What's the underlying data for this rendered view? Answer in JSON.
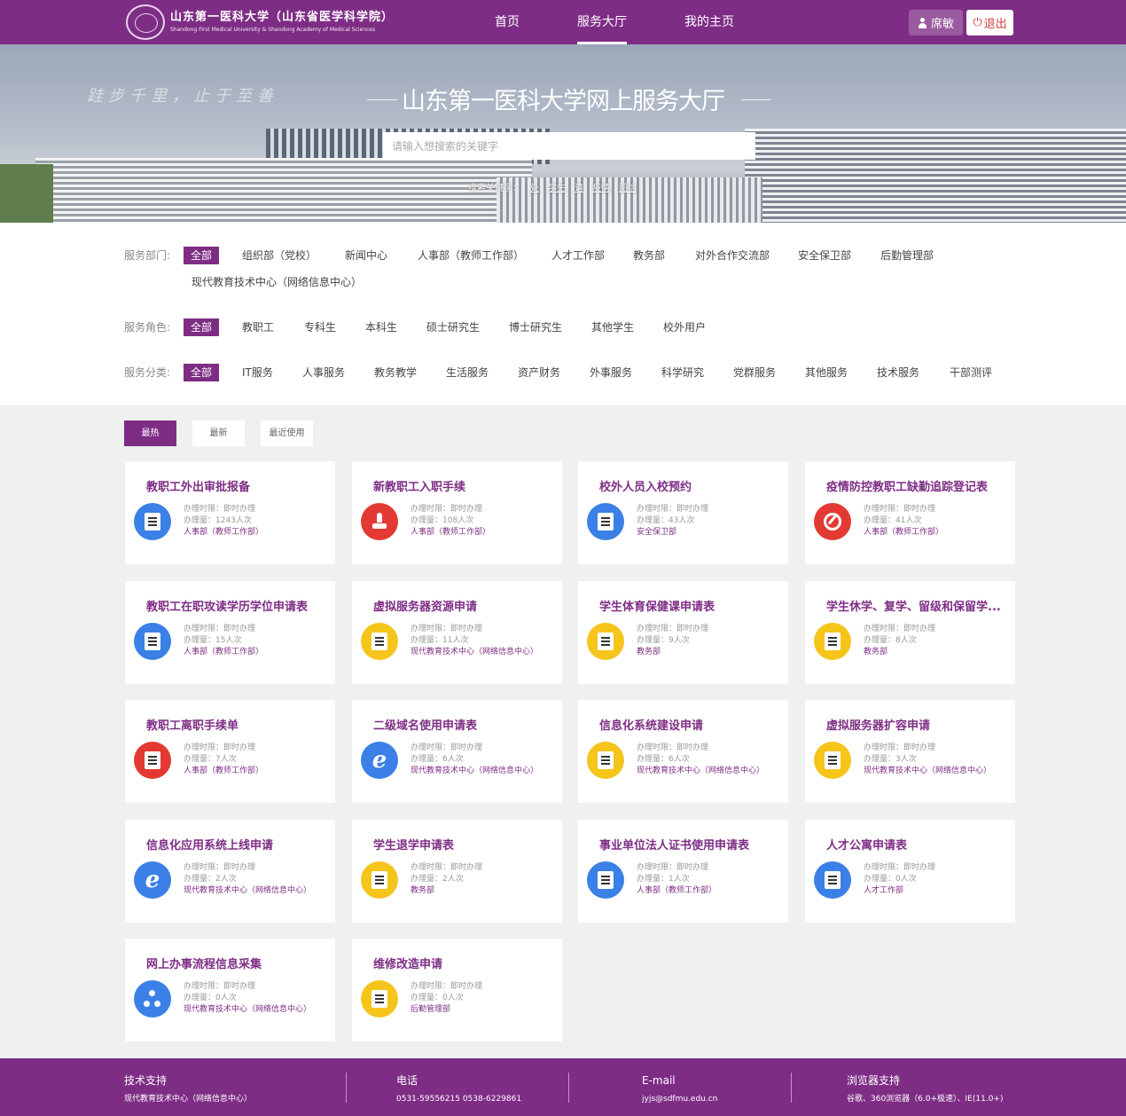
{
  "header": {
    "logo_cn": "山东第一医科大学（山东省医学科学院）",
    "logo_en": "Shandong First Medical University & Shandong Academy of Medical Sciences",
    "nav": [
      "首页",
      "服务大厅",
      "我的主页"
    ],
    "active_nav": "服务大厅",
    "user_name": "席敏",
    "logout_label": "退出"
  },
  "banner": {
    "calligraphy": "跬步千里，止于至善",
    "title": "山东第一医科大学网上服务大厅",
    "search_placeholder": "请输入想搜索的关键字",
    "keywords_label": "搜索关键字：",
    "keywords": [
      "处",
      "学生",
      "请",
      "疫情",
      "图信"
    ]
  },
  "filters": {
    "department": {
      "label": "服务部门:",
      "all": "全部",
      "items": [
        "组织部（党校）",
        "新闻中心",
        "人事部（教师工作部）",
        "人才工作部",
        "教务部",
        "对外合作交流部",
        "安全保卫部",
        "后勤管理部",
        "现代教育技术中心（网络信息中心）"
      ]
    },
    "role": {
      "label": "服务角色:",
      "all": "全部",
      "items": [
        "教职工",
        "专科生",
        "本科生",
        "硕士研究生",
        "博士研究生",
        "其他学生",
        "校外用户"
      ]
    },
    "category": {
      "label": "服务分类:",
      "all": "全部",
      "items": [
        "IT服务",
        "人事服务",
        "教务教学",
        "生活服务",
        "资产财务",
        "外事服务",
        "科学研究",
        "党群服务",
        "其他服务",
        "技术服务",
        "干部测评"
      ]
    }
  },
  "sort_tabs": [
    "最热",
    "最新",
    "最近使用"
  ],
  "labels": {
    "time_prefix": "办理时限：",
    "count_prefix": "办理量：",
    "time_value": "即时办理"
  },
  "cards": [
    {
      "title": "教职工外出审批报备",
      "count": "1243人次",
      "dept": "人事部（教师工作部）",
      "icon": "clipboard-clock-icon",
      "color": "#3b80e6"
    },
    {
      "title": "新教职工入职手续",
      "count": "108人次",
      "dept": "人事部（教师工作部）",
      "icon": "stamp-icon",
      "color": "#e23a32"
    },
    {
      "title": "校外人员入校预约",
      "count": "43人次",
      "dept": "安全保卫部",
      "icon": "wallet-icon",
      "color": "#3b80e6"
    },
    {
      "title": "疫情防控教职工缺勤追踪登记表",
      "count": "41人次",
      "dept": "人事部（教师工作部）",
      "icon": "pen-circle-icon",
      "color": "#e23a32"
    },
    {
      "title": "教职工在职攻读学历学位申请表",
      "count": "15人次",
      "dept": "人事部（教师工作部）",
      "icon": "id-card-icon",
      "color": "#3b80e6"
    },
    {
      "title": "虚拟服务器资源申请",
      "count": "11人次",
      "dept": "现代教育技术中心（网络信息中心）",
      "icon": "document-icon",
      "color": "#f6c51c"
    },
    {
      "title": "学生体育保健课申请表",
      "count": "9人次",
      "dept": "教务部",
      "icon": "checklist-icon",
      "color": "#f6c51c"
    },
    {
      "title": "学生休学、复学、留级和保留学...",
      "count": "8人次",
      "dept": "教务部",
      "icon": "edit-document-icon",
      "color": "#f6c51c"
    },
    {
      "title": "教职工离职手续单",
      "count": "7人次",
      "dept": "人事部（教师工作部）",
      "icon": "form-icon",
      "color": "#e23a32"
    },
    {
      "title": "二级域名使用申请表",
      "count": "6人次",
      "dept": "现代教育技术中心（网络信息中心）",
      "icon": "ie-icon",
      "color": "#3b80e6"
    },
    {
      "title": "信息化系统建设申请",
      "count": "6人次",
      "dept": "现代教育技术中心（网络信息中心）",
      "icon": "document-icon",
      "color": "#f6c51c"
    },
    {
      "title": "虚拟服务器扩容申请",
      "count": "3人次",
      "dept": "现代教育技术中心（网络信息中心）",
      "icon": "document-icon",
      "color": "#f6c51c"
    },
    {
      "title": "信息化应用系统上线申请",
      "count": "2人次",
      "dept": "现代教育技术中心（网络信息中心）",
      "icon": "ie-icon",
      "color": "#3b80e6"
    },
    {
      "title": "学生退学申请表",
      "count": "2人次",
      "dept": "教务部",
      "icon": "notebook-icon",
      "color": "#f6c51c"
    },
    {
      "title": "事业单位法人证书使用申请表",
      "count": "1人次",
      "dept": "人事部（教师工作部）",
      "icon": "cursor-window-icon",
      "color": "#3b80e6"
    },
    {
      "title": "人才公寓申请表",
      "count": "0人次",
      "dept": "人才工作部",
      "icon": "building-icon",
      "color": "#3b80e6"
    },
    {
      "title": "网上办事流程信息采集",
      "count": "0人次",
      "dept": "现代教育技术中心（网络信息中心）",
      "icon": "network-icon",
      "color": "#3b80e6"
    },
    {
      "title": "维修改造申请",
      "count": "0人次",
      "dept": "后勤管理部",
      "icon": "edit-document-icon",
      "color": "#f6c51c"
    }
  ],
  "footer": {
    "support_label": "技术支持",
    "support_value": "现代教育技术中心（网络信息中心）",
    "phone_label": "电话",
    "phone_value": "0531-59556215 0538-6229861",
    "email_label": "E-mail",
    "email_value": "jyjs@sdfmu.edu.cn",
    "browser_label": "浏览器支持",
    "browser_value": "谷歌、360浏览器（6.0+极速）、IE(11.0+)"
  }
}
